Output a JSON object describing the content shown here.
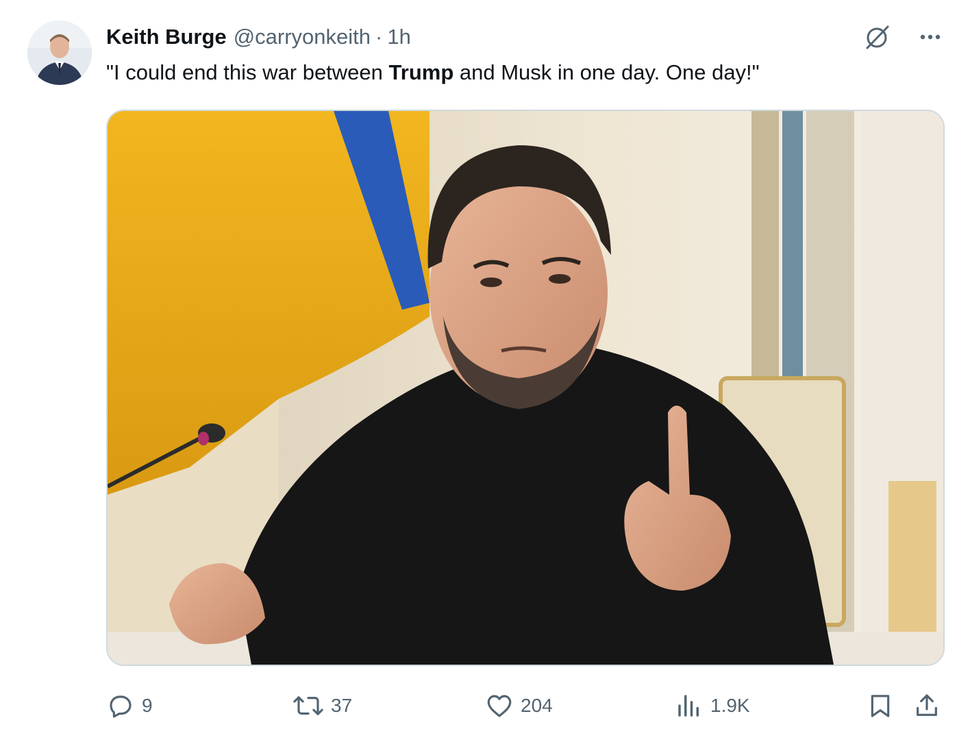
{
  "tweet": {
    "display_name": "Keith Burge",
    "handle": "@carryonkeith",
    "separator": "·",
    "time": "1h",
    "text_before": "\"I could end this war between ",
    "text_bold": "Trump",
    "text_after": " and Musk in one day. One day!\""
  },
  "icons": {
    "avatar": "avatar",
    "grok": "grok-icon",
    "more": "more-icon",
    "reply": "reply-icon",
    "retweet": "retweet-icon",
    "like": "like-icon",
    "views": "views-icon",
    "bookmark": "bookmark-icon",
    "share": "share-icon"
  },
  "actions": {
    "replies": "9",
    "retweets": "37",
    "likes": "204",
    "views": "1.9K"
  },
  "colors": {
    "text_primary": "#0f1419",
    "text_secondary": "#536471",
    "border": "#cfd9de"
  }
}
